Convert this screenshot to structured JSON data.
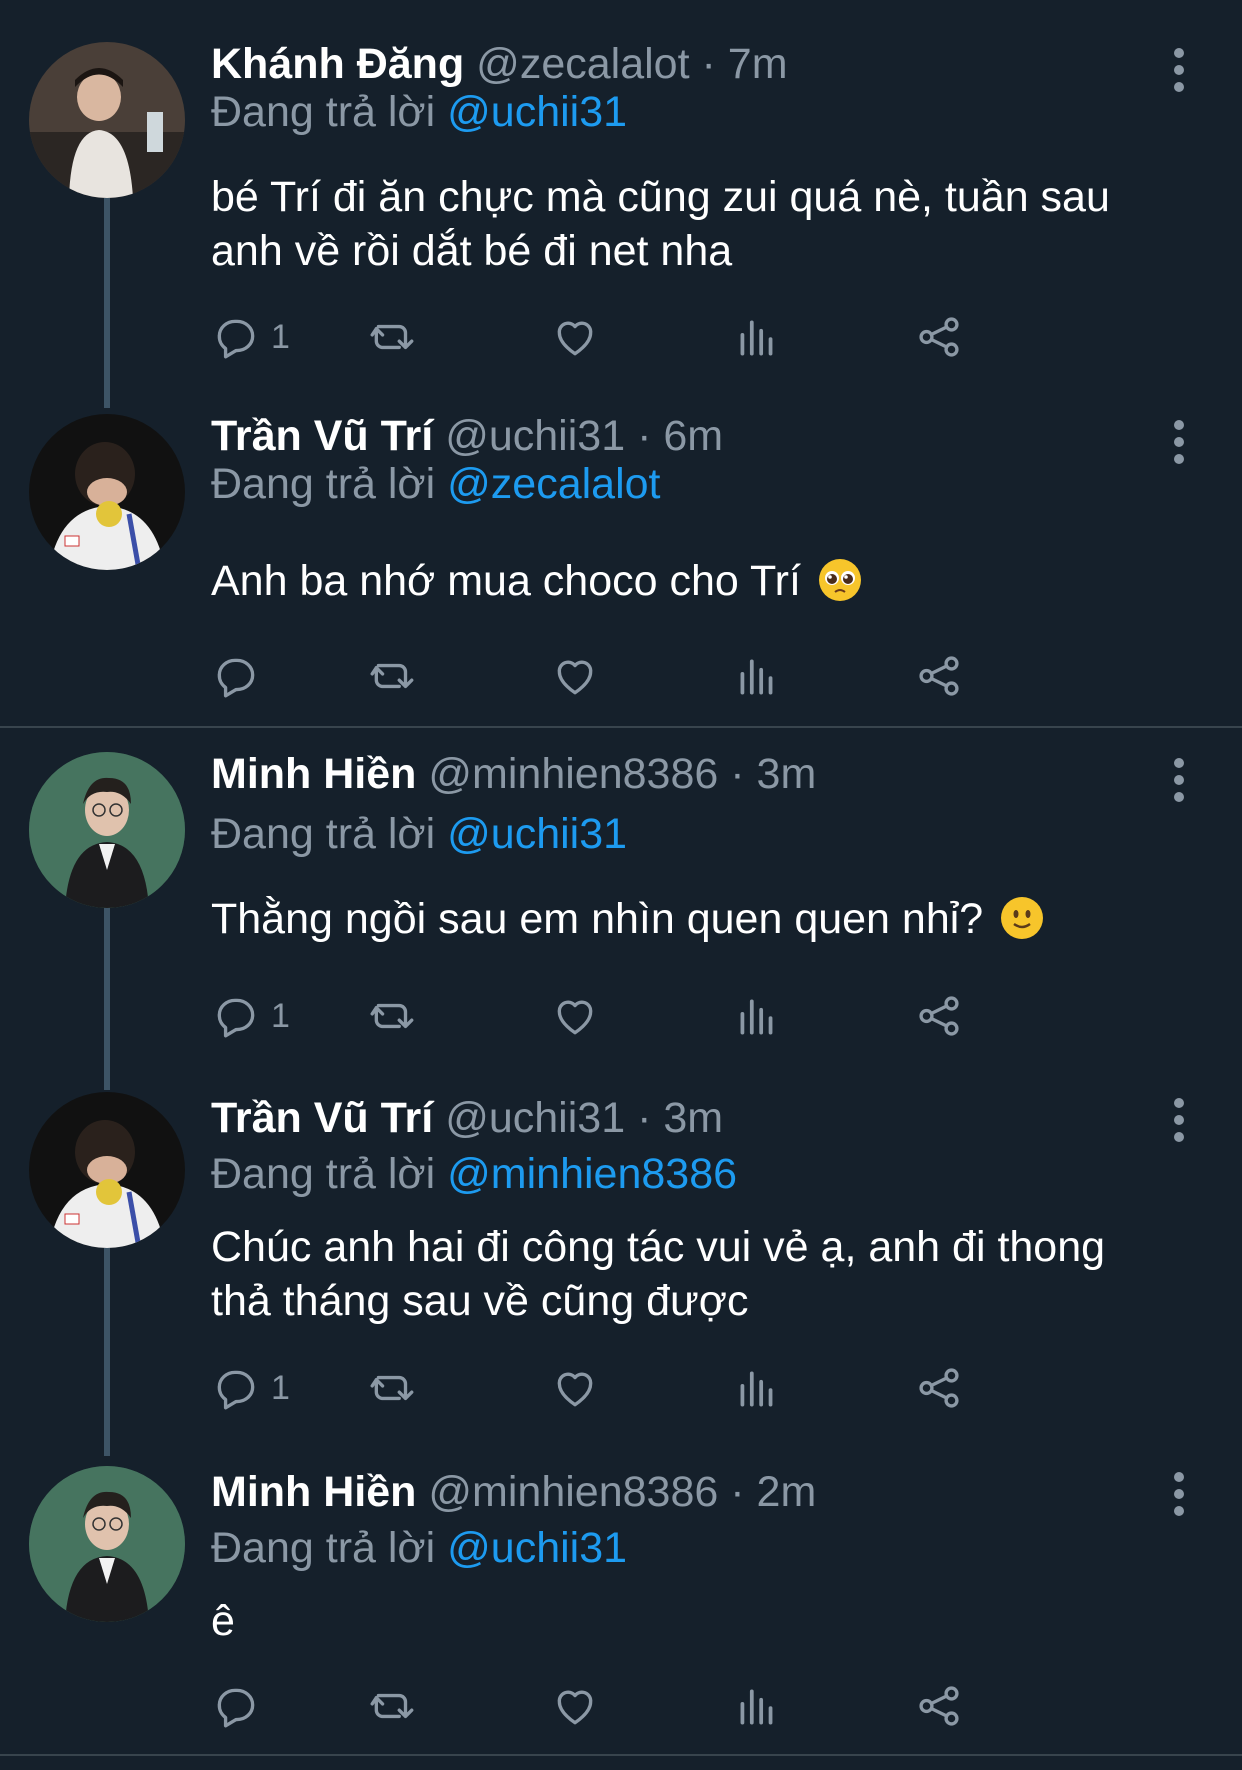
{
  "theme": {
    "background": "#15202b",
    "text": "#ffffff",
    "muted": "#8b98a5",
    "link": "#1d9bf0",
    "thread_line": "#3d5466"
  },
  "icons": {
    "reply": "reply-icon",
    "retweet": "retweet-icon",
    "like": "heart-icon",
    "views": "views-icon",
    "share": "share-icon",
    "more": "more-vertical-icon"
  },
  "tweets": [
    {
      "name": "Khánh Đăng",
      "handle": "@zecalalot",
      "separator": "·",
      "time": "7m",
      "reply_prefix": "Đang trả lời",
      "reply_to": "@uchii31",
      "text": "bé Trí đi ăn chực mà cũng zui quá nè, tuần sau anh về rồi dắt bé đi net nha",
      "emoji": "",
      "reply_count": "1"
    },
    {
      "name": "Trần Vũ Trí",
      "handle": "@uchii31",
      "separator": "·",
      "time": "6m",
      "reply_prefix": "Đang trả lời",
      "reply_to": "@zecalalot",
      "text": "Anh ba nhớ mua choco cho Trí",
      "emoji": "pleading-face-emoji",
      "reply_count": ""
    },
    {
      "name": "Minh Hiền",
      "handle": "@minhien8386",
      "separator": "·",
      "time": "3m",
      "reply_prefix": "Đang trả lời",
      "reply_to": "@uchii31",
      "text": "Thằng ngồi sau em nhìn quen quen nhỉ?",
      "emoji": "slightly-smiling-face-emoji",
      "reply_count": "1"
    },
    {
      "name": "Trần Vũ Trí",
      "handle": "@uchii31",
      "separator": "·",
      "time": "3m",
      "reply_prefix": "Đang trả lời",
      "reply_to": "@minhien8386",
      "text": "Chúc anh hai đi công tác vui vẻ ạ, anh đi thong thả tháng sau về cũng được",
      "emoji": "",
      "reply_count": "1"
    },
    {
      "name": "Minh Hiền",
      "handle": "@minhien8386",
      "separator": "·",
      "time": "2m",
      "reply_prefix": "Đang trả lời",
      "reply_to": "@uchii31",
      "text": "ê",
      "emoji": "",
      "reply_count": ""
    }
  ]
}
